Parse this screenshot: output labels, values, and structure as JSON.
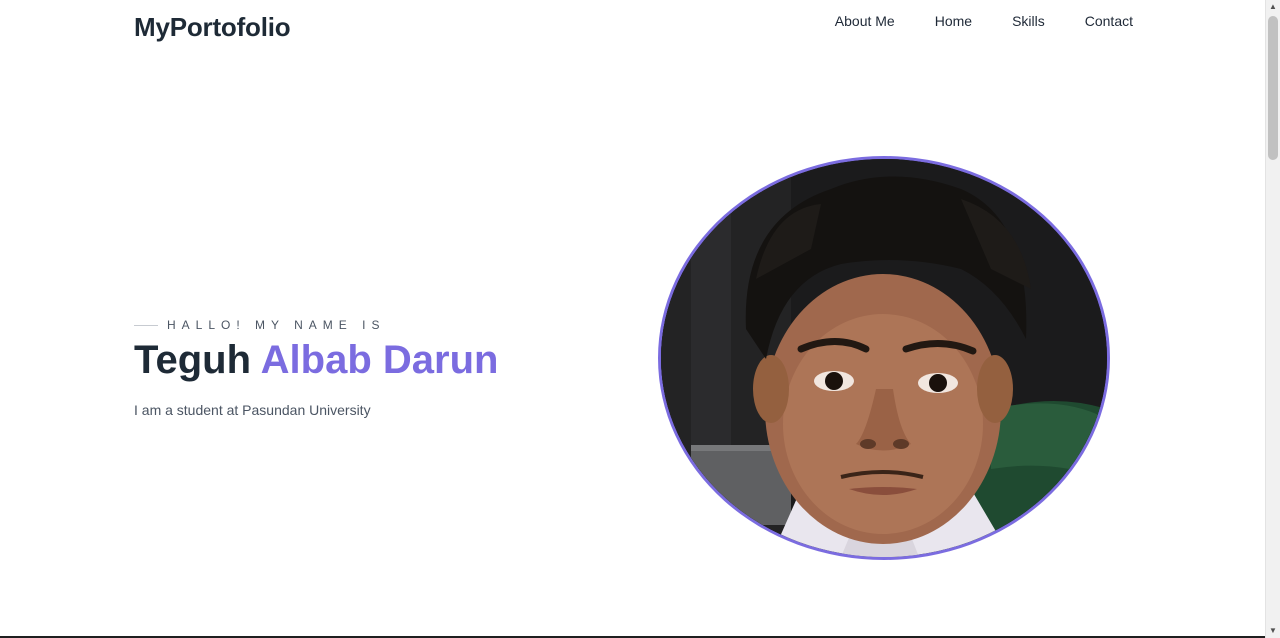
{
  "header": {
    "brand": "MyPortofolio",
    "nav": [
      "About Me",
      "Home",
      "Skills",
      "Contact"
    ]
  },
  "hero": {
    "eyebrow": "HALLO! MY NAME IS",
    "name_first": "Teguh",
    "name_rest": "Albab Darun",
    "subtitle": "I am a student at Pasundan University"
  },
  "colors": {
    "accent": "#7b6ce0",
    "heading": "#1e2a36",
    "text": "#4b5563"
  },
  "icons": {
    "scroll_up": "triangle-up",
    "scroll_down": "triangle-down"
  }
}
